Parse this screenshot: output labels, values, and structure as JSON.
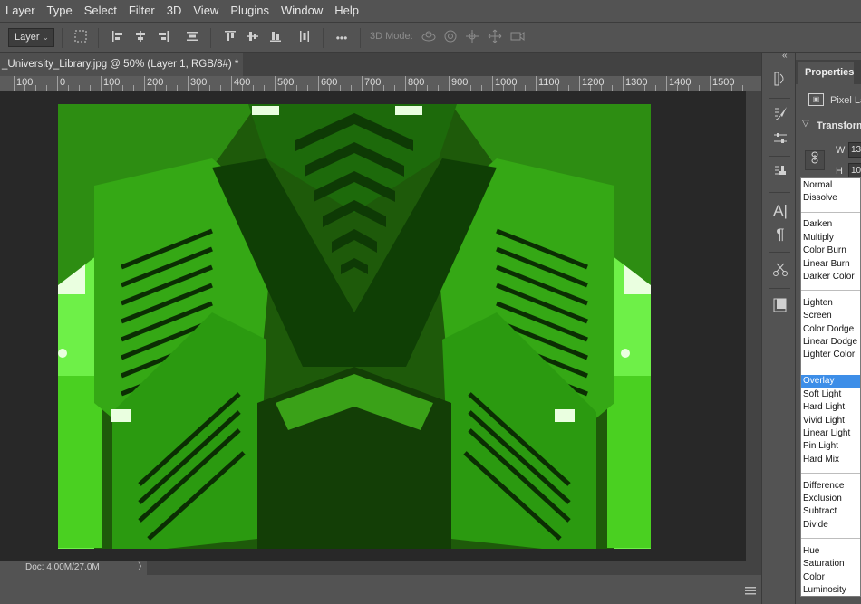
{
  "menu": [
    "Layer",
    "Type",
    "Select",
    "Filter",
    "3D",
    "View",
    "Plugins",
    "Window",
    "Help"
  ],
  "options": {
    "auto_select_value": "Layer",
    "more_label": "•••",
    "mode_label": "3D Mode:"
  },
  "document": {
    "tab_title": "_University_Library.jpg @ 50% (Layer 1, RGB/8#) *",
    "tab_close": "×"
  },
  "ruler": {
    "labels": [
      "100",
      "0",
      "100",
      "200",
      "300",
      "400",
      "500",
      "600",
      "700",
      "800",
      "900",
      "1000",
      "1100",
      "1200",
      "1300",
      "1400",
      "1500"
    ]
  },
  "status": {
    "doc_size": "Doc: 4.00M/27.0M",
    "more": "〉"
  },
  "image": {
    "description_color": "#2bd40d"
  },
  "properties": {
    "tab_label": "Properties",
    "layer_type": "Pixel Layer",
    "section_label": "Transform",
    "width_label": "W",
    "width_value": "13",
    "height_label": "H",
    "height_value": "10"
  },
  "blend_modes": {
    "groups": [
      [
        "Normal",
        "Dissolve"
      ],
      [
        "Darken",
        "Multiply",
        "Color Burn",
        "Linear Burn",
        "Darker Color"
      ],
      [
        "Lighten",
        "Screen",
        "Color Dodge",
        "Linear Dodge (",
        "Lighter Color"
      ],
      [
        "Overlay",
        "Soft Light",
        "Hard Light",
        "Vivid Light",
        "Linear Light",
        "Pin Light",
        "Hard Mix"
      ],
      [
        "Difference",
        "Exclusion",
        "Subtract",
        "Divide"
      ],
      [
        "Hue",
        "Saturation",
        "Color",
        "Luminosity"
      ]
    ],
    "selected": "Overlay",
    "selected_color": "#3d8ee8"
  },
  "colors": {
    "ui_bg": "#535353",
    "canvas_bg": "#282828",
    "accent": "#3d8ee8"
  }
}
